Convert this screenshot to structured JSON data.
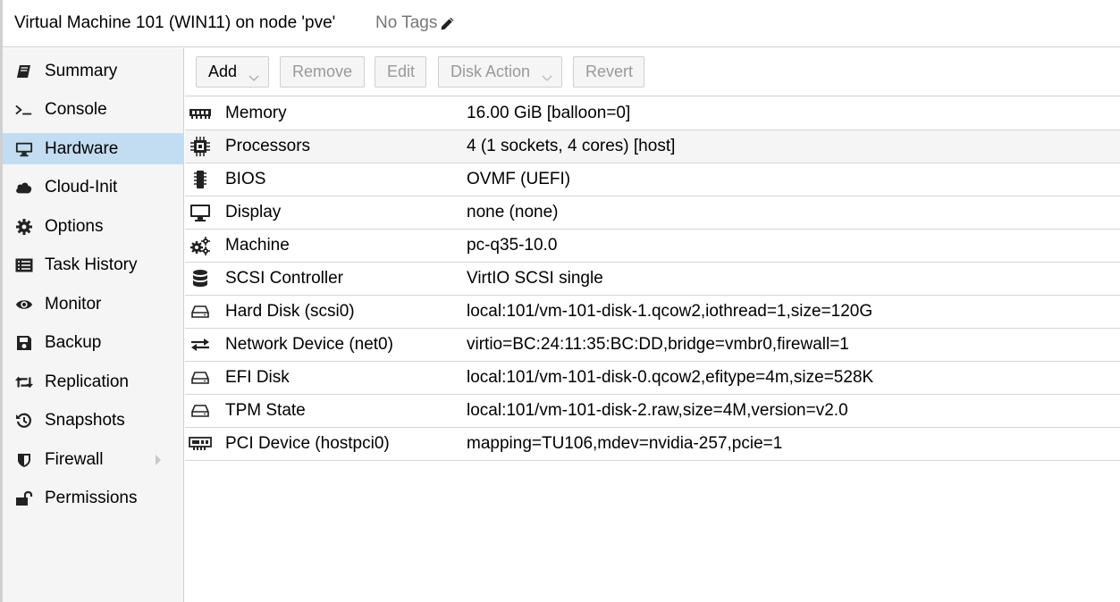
{
  "header": {
    "title": "Virtual Machine 101 (WIN11) on node 'pve'",
    "tags": "No Tags"
  },
  "sidebar": {
    "items": [
      {
        "label": "Summary",
        "icon": "book-icon"
      },
      {
        "label": "Console",
        "icon": "terminal-icon"
      },
      {
        "label": "Hardware",
        "icon": "monitor-icon",
        "active": true
      },
      {
        "label": "Cloud-Init",
        "icon": "cloud-icon"
      },
      {
        "label": "Options",
        "icon": "gear-icon"
      },
      {
        "label": "Task History",
        "icon": "list-icon"
      },
      {
        "label": "Monitor",
        "icon": "eye-icon"
      },
      {
        "label": "Backup",
        "icon": "floppy-icon"
      },
      {
        "label": "Replication",
        "icon": "retweet-icon"
      },
      {
        "label": "Snapshots",
        "icon": "history-icon"
      },
      {
        "label": "Firewall",
        "icon": "shield-icon"
      },
      {
        "label": "Permissions",
        "icon": "unlock-icon"
      }
    ]
  },
  "toolbar": {
    "add_label": "Add",
    "remove_label": "Remove",
    "edit_label": "Edit",
    "disk_action_label": "Disk Action",
    "revert_label": "Revert"
  },
  "hardware": {
    "rows": [
      {
        "name": "Memory",
        "value": "16.00 GiB [balloon=0]",
        "icon": "memory-icon"
      },
      {
        "name": "Processors",
        "value": "4 (1 sockets, 4 cores) [host]",
        "icon": "cpu-icon"
      },
      {
        "name": "BIOS",
        "value": "OVMF (UEFI)",
        "icon": "microchip-icon"
      },
      {
        "name": "Display",
        "value": "none (none)",
        "icon": "desktop-icon"
      },
      {
        "name": "Machine",
        "value": "pc-q35-10.0",
        "icon": "cogs-icon"
      },
      {
        "name": "SCSI Controller",
        "value": "VirtIO SCSI single",
        "icon": "database-icon"
      },
      {
        "name": "Hard Disk (scsi0)",
        "value": "local:101/vm-101-disk-1.qcow2,iothread=1,size=120G",
        "icon": "hdd-icon"
      },
      {
        "name": "Network Device (net0)",
        "value": "virtio=BC:24:11:35:BC:DD,bridge=vmbr0,firewall=1",
        "icon": "exchange-icon"
      },
      {
        "name": "EFI Disk",
        "value": "local:101/vm-101-disk-0.qcow2,efitype=4m,size=528K",
        "icon": "hdd-icon"
      },
      {
        "name": "TPM State",
        "value": "local:101/vm-101-disk-2.raw,size=4M,version=v2.0",
        "icon": "hdd-icon"
      },
      {
        "name": "PCI Device (hostpci0)",
        "value": "mapping=TU106,mdev=nvidia-257,pcie=1",
        "icon": "pci-card-icon"
      }
    ]
  }
}
